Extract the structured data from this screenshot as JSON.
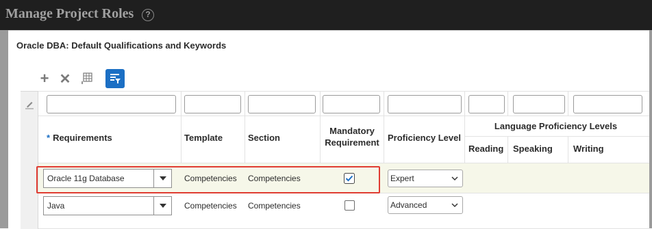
{
  "window": {
    "title": "Manage Project Roles",
    "help_icon": "help-circle-icon",
    "help_glyph": "?"
  },
  "dialog": {
    "title": "Oracle DBA: Default Qualifications and Keywords",
    "toolbar": {
      "add": {
        "icon": "plus-icon",
        "glyph": "+"
      },
      "delete": {
        "icon": "x-icon",
        "glyph": "✕"
      },
      "freeze": {
        "icon": "freeze-columns-icon"
      },
      "query_by_example": {
        "icon": "filter-icon",
        "active": true
      }
    },
    "columns": {
      "requirements": {
        "label": "Requirements",
        "required_marker": "*"
      },
      "template": {
        "label": "Template"
      },
      "section": {
        "label": "Section"
      },
      "mandatory": {
        "label_line1": "Mandatory",
        "label_line2": "Requirement"
      },
      "proficiency": {
        "label": "Proficiency Level"
      },
      "language_group": {
        "label": "Language Proficiency Levels"
      },
      "reading": {
        "label": "Reading"
      },
      "speaking": {
        "label": "Speaking"
      },
      "writing": {
        "label": "Writing"
      }
    },
    "rows": [
      {
        "requirement": "Oracle 11g Database",
        "template": "Competencies",
        "section": "Competencies",
        "mandatory": true,
        "proficiency": "Expert",
        "selected": true
      },
      {
        "requirement": "Java",
        "template": "Competencies",
        "section": "Competencies",
        "mandatory": false,
        "proficiency": "Advanced",
        "selected": false
      }
    ],
    "annotation": {
      "color": "#e03b31"
    },
    "colors": {
      "accent": "#1b6fc4",
      "titlebar": "#1f1f1f",
      "selected_row": "#f6f7e9"
    }
  }
}
